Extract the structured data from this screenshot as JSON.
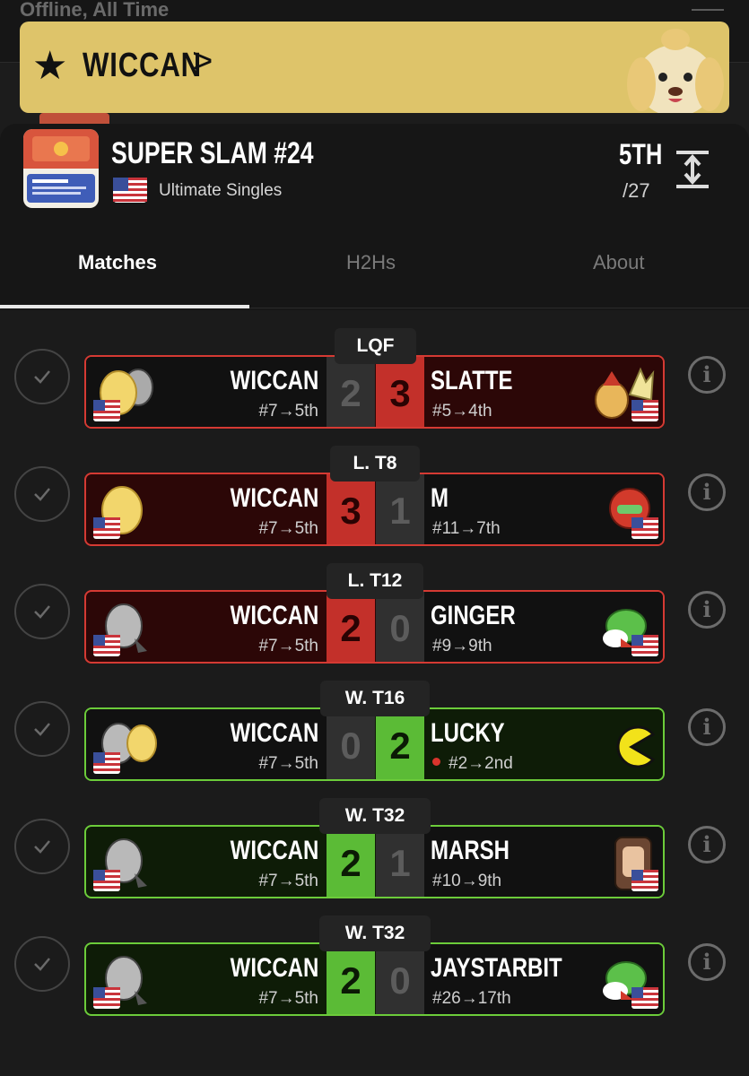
{
  "topbar": {
    "text": "Offline, All Time"
  },
  "banner": {
    "player": "WICCAN",
    "chevron": ">"
  },
  "event": {
    "title": "SUPER SLAM #24",
    "game": "Ultimate Singles",
    "placing": "5TH",
    "entrants": "/27"
  },
  "tabs": [
    {
      "label": "Matches"
    },
    {
      "label": "H2Hs"
    },
    {
      "label": "About"
    }
  ],
  "matches": [
    {
      "round": "LQF",
      "left_name": "WICCAN",
      "left_seed": "#7→5th",
      "left_score": "2",
      "right_score": "3",
      "right_name": "SLATTE",
      "right_seed": "#5→4th",
      "result": "loss"
    },
    {
      "round": "L. T8",
      "left_name": "WICCAN",
      "left_seed": "#7→5th",
      "left_score": "3",
      "right_score": "1",
      "right_name": "M",
      "right_seed": "#11→7th",
      "result": "loss"
    },
    {
      "round": "L. T12",
      "left_name": "WICCAN",
      "left_seed": "#7→5th",
      "left_score": "2",
      "right_score": "0",
      "right_name": "GINGER",
      "right_seed": "#9→9th",
      "result": "loss"
    },
    {
      "round": "W. T16",
      "left_name": "WICCAN",
      "left_seed": "#7→5th",
      "left_score": "0",
      "right_score": "2",
      "right_name": "LUCKY",
      "right_seed": "#2→2nd",
      "result": "win"
    },
    {
      "round": "W. T32",
      "left_name": "WICCAN",
      "left_seed": "#7→5th",
      "left_score": "2",
      "right_score": "1",
      "right_name": "MARSH",
      "right_seed": "#10→9th",
      "result": "win"
    },
    {
      "round": "W. T32",
      "left_name": "WICCAN",
      "left_seed": "#7→5th",
      "left_score": "2",
      "right_score": "0",
      "right_name": "JAYSTARBIT",
      "right_seed": "#26→17th",
      "result": "win"
    }
  ],
  "colors": {
    "gold": "#dec46a",
    "loss_red": "#c3302a",
    "win_green": "#5bbb36"
  }
}
